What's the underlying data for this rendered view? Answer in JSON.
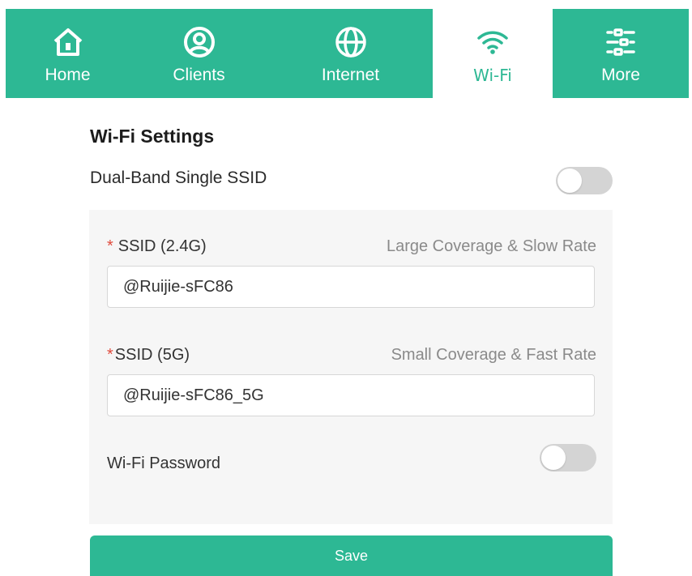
{
  "nav": {
    "tabs": [
      {
        "label": "Home",
        "icon": "home-icon"
      },
      {
        "label": "Clients",
        "icon": "user-circle-icon"
      },
      {
        "label": "Internet",
        "icon": "globe-icon"
      },
      {
        "label": "Wi-Fi",
        "icon": "wifi-icon",
        "active": true
      },
      {
        "label": "More",
        "icon": "sliders-icon"
      }
    ]
  },
  "wifi": {
    "title": "Wi-Fi Settings",
    "dual_band_label": "Dual-Band Single SSID",
    "dual_band_enabled": false,
    "ssid_24": {
      "required_mark": "*",
      "label": "SSID (2.4G)",
      "hint": "Large Coverage & Slow Rate",
      "value": "@Ruijie-sFC86"
    },
    "ssid_5": {
      "required_mark": "*",
      "label": "SSID (5G)",
      "hint": "Small Coverage & Fast Rate",
      "value": "@Ruijie-sFC86_5G"
    },
    "password_label": "Wi-Fi Password",
    "password_enabled": false,
    "save_label": "Save"
  },
  "colors": {
    "accent": "#2db894",
    "toggle_off": "#d4d4d4",
    "panel_bg": "#f6f6f6",
    "required": "#e04b3d"
  }
}
